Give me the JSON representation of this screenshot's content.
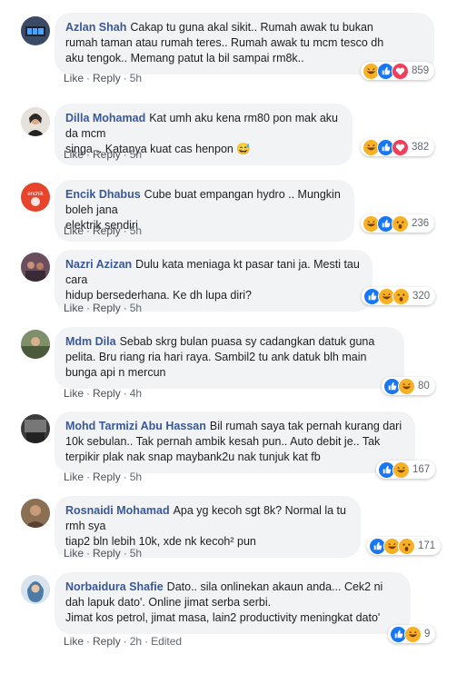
{
  "comments": [
    {
      "author": "Azlan Shah",
      "text": "Cakap tu guna akal sikit.. Rumah awak tu bukan\nrumah taman atau rumah teres.. Rumah awak tu mcm tesco dh\naku tengok.. Memang patut la bil sampai rm8k..",
      "like": "Like",
      "reply": "Reply",
      "time": "5h",
      "reaction_count": "859",
      "reactions": [
        "haha",
        "like",
        "love"
      ]
    },
    {
      "author": "Dilla Mohamad",
      "text": "Kat umh aku kena rm80 pon mak aku da mcm\nsinga .. Katanya kuat cas henpon 😅",
      "like": "Like",
      "reply": "Reply",
      "time": "5h",
      "reaction_count": "382",
      "reactions": [
        "haha",
        "like",
        "love"
      ]
    },
    {
      "author": "Encik Dhabus",
      "text": "Cube buat empangan hydro .. Mungkin boleh jana\nelektrik sendiri",
      "like": "Like",
      "reply": "Reply",
      "time": "5h",
      "reaction_count": "236",
      "reactions": [
        "haha",
        "like",
        "wow"
      ]
    },
    {
      "author": "Nazri Azizan",
      "text": "Dulu kata meniaga kt pasar tani ja. Mesti tau cara\nhidup bersederhana. Ke dh lupa diri?",
      "like": "Like",
      "reply": "Reply",
      "time": "5h",
      "reaction_count": "320",
      "reactions": [
        "like",
        "haha",
        "wow"
      ]
    },
    {
      "author": "Mdm Dila",
      "text": "Sebab skrg bulan puasa sy cadangkan datuk guna\npelita. Bru riang ria hari raya. Sambil2 tu ank datuk blh main\nbunga api n mercun",
      "like": "Like",
      "reply": "Reply",
      "time": "4h",
      "reaction_count": "80",
      "reactions": [
        "like",
        "haha"
      ]
    },
    {
      "author": "Mohd Tarmizi Abu Hassan",
      "text": "Bil rumah saya tak pernah kurang dari\n10k sebulan.. Tak pernah ambik kesah pun.. Auto debit je.. Tak\nterpikir plak nak snap maybank2u nak tunjuk kat fb",
      "like": "Like",
      "reply": "Reply",
      "time": "5h",
      "reaction_count": "167",
      "reactions": [
        "like",
        "haha"
      ]
    },
    {
      "author": "Rosnaidi Mohamad",
      "text": "Apa yg kecoh sgt 8k? Normal la tu rmh sya\ntiap2 bln lebih 10k, xde nk kecoh² pun",
      "like": "Like",
      "reply": "Reply",
      "time": "5h",
      "reaction_count": "171",
      "reactions": [
        "like",
        "haha",
        "wow"
      ]
    },
    {
      "author": "Norbaidura Shafie",
      "text": "Dato.. sila onlinekan akaun anda... Cek2 ni\ndah lapuk dato'. Online jimat serba serbi.\nJimat kos petrol, jimat masa, lain2 productivity meningkat dato'",
      "like": "Like",
      "reply": "Reply",
      "time": "2h",
      "edited": "Edited",
      "reaction_count": "9",
      "reactions": [
        "like",
        "haha"
      ]
    }
  ],
  "colors": {
    "author_link": "#385898",
    "bubble_bg": "#f2f3f5",
    "like_blue": "#1877f2",
    "love_red": "#f33e58",
    "haha_yellow": "#f7b125"
  }
}
